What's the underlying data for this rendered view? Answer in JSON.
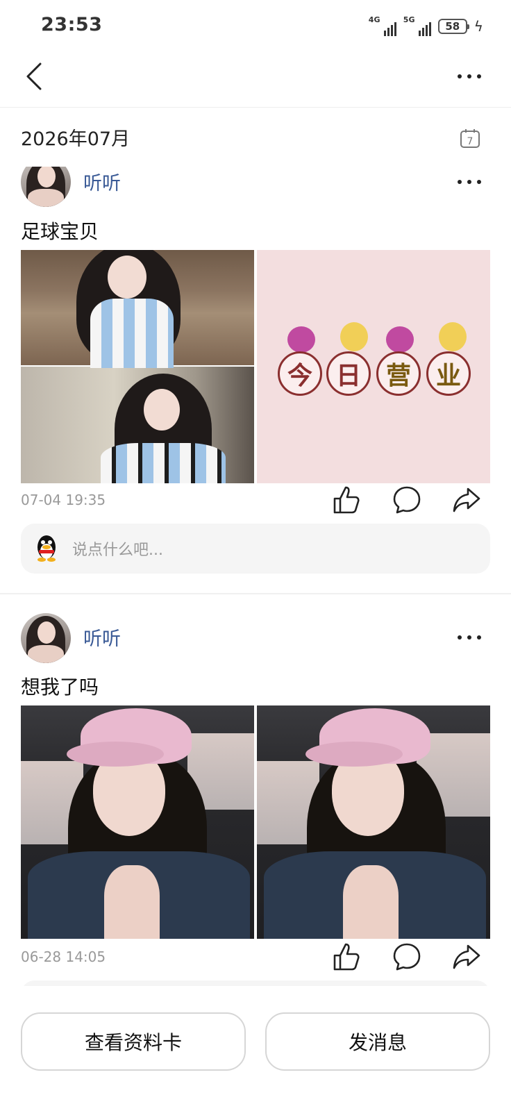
{
  "status_bar": {
    "time": "23:53",
    "network_1": "4G",
    "network_2": "5G",
    "battery": "58"
  },
  "feed": {
    "month_label": "2026年07月",
    "calendar_day": "7"
  },
  "posts": [
    {
      "username": "听听",
      "text": "足球宝贝",
      "time": "07-04 19:35",
      "overlay_chars": [
        "今",
        "日",
        "营",
        "业"
      ],
      "comment_placeholder": "说点什么吧..."
    },
    {
      "username": "听听",
      "text": "想我了吗",
      "time": "06-28 14:05"
    }
  ],
  "bottom_bar": {
    "view_profile_label": "查看资料卡",
    "send_message_label": "发消息"
  },
  "colors": {
    "username": "#3a5a96",
    "timestamp": "#999999",
    "overlay_dark_red": "#8a2f2f",
    "overlay_olive": "#7a5a10"
  }
}
